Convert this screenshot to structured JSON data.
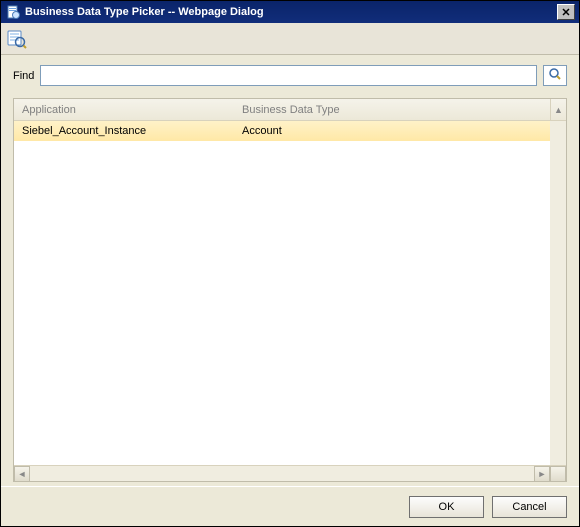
{
  "window": {
    "title": "Business Data Type Picker -- Webpage Dialog"
  },
  "find": {
    "label": "Find",
    "value": "",
    "placeholder": ""
  },
  "grid": {
    "columns": {
      "application": "Application",
      "business_data_type": "Business Data Type"
    },
    "rows": [
      {
        "application": "Siebel_Account_Instance",
        "business_data_type": "Account",
        "selected": true
      }
    ]
  },
  "buttons": {
    "ok": "OK",
    "cancel": "Cancel"
  },
  "icons": {
    "title_page": "page-icon",
    "toolbar_search": "data-search-icon",
    "find_search": "search-icon",
    "close": "✕",
    "arrow_up": "▲",
    "arrow_left": "◄",
    "arrow_right": "►"
  }
}
